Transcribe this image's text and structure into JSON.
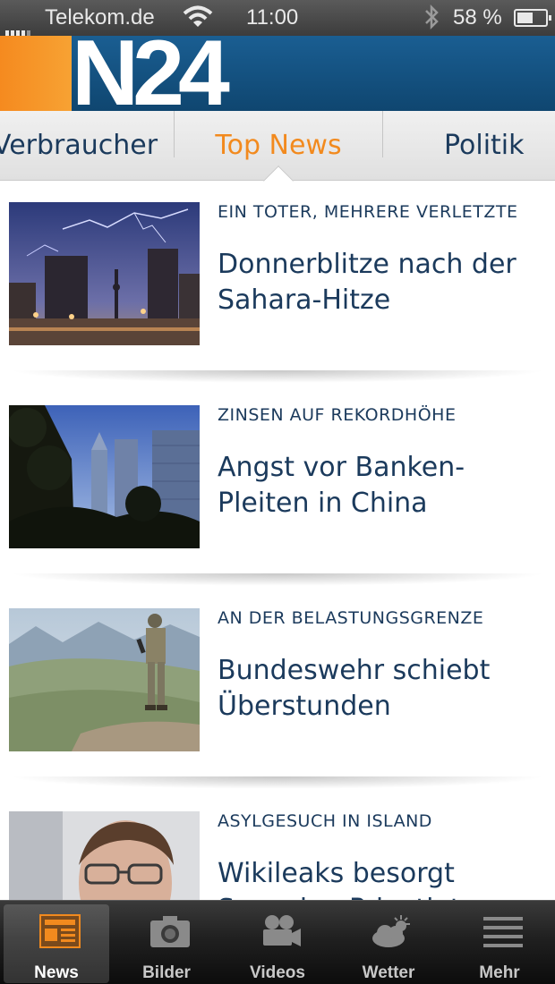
{
  "status_bar": {
    "carrier": "Telekom.de",
    "time": "11:00",
    "battery_text": "58 %",
    "battery_level": 0.58
  },
  "header": {
    "logo": "N24"
  },
  "sections": {
    "left": "Verbraucher",
    "active": "Top News",
    "right": "Politik"
  },
  "articles": [
    {
      "kicker": "EIN TOTER, MEHRERE VERLETZTE",
      "headline": "Donnerblitze nach der Sahara-Hitze",
      "image_icon": "thunderstorm-city-photo"
    },
    {
      "kicker": "ZINSEN AUF REKORDHÖHE",
      "headline": "Angst vor Banken-Pleiten in China",
      "image_icon": "skyscrapers-photo"
    },
    {
      "kicker": "AN DER BELASTUNGSGRENZE",
      "headline": "Bundeswehr schiebt Überstunden",
      "image_icon": "soldier-photo"
    },
    {
      "kicker": "ASYLGESUCH IN ISLAND",
      "headline": "Wikileaks besorgt Snowden Privatjet",
      "image_icon": "portrait-photo"
    }
  ],
  "tabbar": {
    "items": [
      {
        "label": "News",
        "icon": "newspaper-icon",
        "active": true
      },
      {
        "label": "Bilder",
        "icon": "camera-icon",
        "active": false
      },
      {
        "label": "Videos",
        "icon": "video-camera-icon",
        "active": false
      },
      {
        "label": "Wetter",
        "icon": "weather-icon",
        "active": false
      },
      {
        "label": "Mehr",
        "icon": "menu-icon",
        "active": false
      }
    ]
  },
  "colors": {
    "brand_blue": "#134f7d",
    "brand_orange": "#f28a1e",
    "text_navy": "#1b3a5c"
  }
}
